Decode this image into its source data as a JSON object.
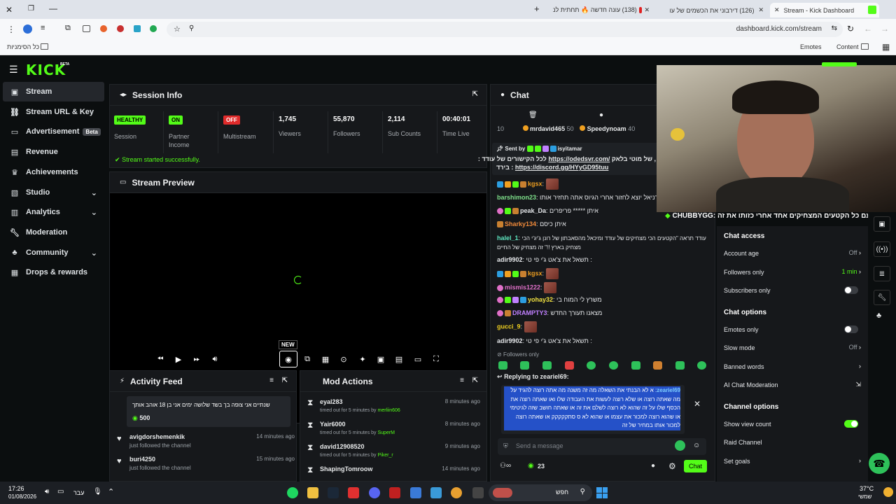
{
  "browser": {
    "tabs": [
      {
        "label": "Stream - Kick Dashboard",
        "active": true
      },
      {
        "label": "(126) דירבוני את הכשמים של עו"
      },
      {
        "label": "(138) עונה חדשה 🔥 תחתית לנ"
      }
    ],
    "url": "dashboard.kick.com/stream",
    "bookmarks_label": "כל הסימניות",
    "bookmarks": [
      "Emotes",
      "Content"
    ]
  },
  "brand": {
    "logo": "KICK",
    "tag": "BETA",
    "accent": "#53fc18"
  },
  "sidebar": {
    "items": [
      {
        "label": "Stream",
        "icon": "stream-icon",
        "active": true
      },
      {
        "label": "Stream URL & Key",
        "icon": "link-icon"
      },
      {
        "label": "Advertisement",
        "icon": "ad-icon",
        "badge": "Beta"
      },
      {
        "label": "Revenue",
        "icon": "revenue-icon"
      },
      {
        "label": "Achievements",
        "icon": "trophy-icon"
      },
      {
        "label": "Studio",
        "icon": "studio-icon",
        "expandable": true
      },
      {
        "label": "Analytics",
        "icon": "analytics-icon",
        "expandable": true
      },
      {
        "label": "Moderation",
        "icon": "wrench-icon"
      },
      {
        "label": "Community",
        "icon": "community-icon",
        "expandable": true
      },
      {
        "label": "Drops & rewards",
        "icon": "gift-icon"
      }
    ]
  },
  "session": {
    "title": "Session Info",
    "stats": [
      {
        "pill": "HEALTHY",
        "label": "Session",
        "color": "#53fc18"
      },
      {
        "pill": "ON",
        "label": "Partner Income",
        "color": "#53fc18"
      },
      {
        "pill": "OFF",
        "label": "Multistream",
        "color": "#e02b2b"
      },
      {
        "value": "1,745",
        "label": "Viewers"
      },
      {
        "value": "55,870",
        "label": "Followers"
      },
      {
        "value": "2,114",
        "label": "Sub Counts"
      },
      {
        "value": "00:40:01",
        "label": "Time Live"
      }
    ],
    "status_message": "Stream started successfully."
  },
  "preview": {
    "title": "Stream Preview",
    "new_badge": "NEW"
  },
  "activity": {
    "title": "Activity Feed",
    "top_message": "שנתיים אני צופה בך בשד שלושה ימים אני בן 18 אוהב אותך",
    "top_amount": "500",
    "items": [
      {
        "user": "avigdorshemenkik",
        "action": "just followed the channel",
        "time": "14 minutes ago"
      },
      {
        "user": "buri4250",
        "action": "just followed the channel",
        "time": "15 minutes ago"
      }
    ]
  },
  "mod": {
    "title": "Mod Actions",
    "items": [
      {
        "user": "eyal283",
        "text": "timed out for 5 minutes by",
        "by": "merliin606",
        "time": "8 minutes ago"
      },
      {
        "user": "Yair6000",
        "text": "timed out for 5 minutes by",
        "by": "SuperM",
        "time": "8 minutes ago"
      },
      {
        "user": "david12908520",
        "text": "timed out for 5 minutes by",
        "by": "Piker_r",
        "time": "9 minutes ago"
      },
      {
        "user": "ShapingTomroow",
        "text": "timed out for 5 minutes by",
        "by": "",
        "time": "14 minutes ago"
      }
    ]
  },
  "chat": {
    "title": "Chat",
    "leaderboard": [
      {
        "user": "mrdavid465",
        "score": "50"
      },
      {
        "user": "Speedynoam",
        "score": "40"
      }
    ],
    "pinned": {
      "sent_by_label": "Sent by",
      "sender": "isyitamar",
      "line1_prefix": "של מוטי בלאק ,",
      "line1_link": "https://odedsvr.com/",
      "line1_suffix": ": לכל הקישורים של עודד",
      "line2_prefix": "בירד :",
      "line2_link": "https://discord.gg/HYyGD95tuu"
    },
    "messages": [
      {
        "user": "kgsx",
        "text": "",
        "color": "#f0a020",
        "emote": true
      },
      {
        "user": "barshimon23",
        "text": "ודניאל יוצא לחזור אחרי הגיוס אתה תחזיר אותו",
        "color": "#7ee08a"
      },
      {
        "user": "peak_Da",
        "text": "איתן ***** פריפרים",
        "color": "#e5e7ea"
      },
      {
        "user": "Sharky134",
        "text": "איתן כיסם",
        "color": "#f08a3a"
      },
      {
        "user": "halel_1",
        "text": "עודד תראה \"הקטעים הכי מצחיקים של עודד ומיכאל מהסאבתון של רונן ג'יג'י הכי מצחיק בארץ !!\" זה מצחיק של החיים",
        "color": "#5ee6c0"
      },
      {
        "user": "adir9902",
        "text": "תשאל את צ'אט ג'י פי טי :",
        "color": "#e5e7ea"
      },
      {
        "user": "kgsx",
        "text": "",
        "color": "#f0a020",
        "emote": true
      },
      {
        "user": "mismis1222",
        "text": "",
        "color": "#e070c8",
        "emote": true
      },
      {
        "user": "yohay32",
        "text": "משרץ לי המוח בי",
        "color": "#f0e040"
      },
      {
        "user": "DRAMPTY3",
        "text": "מצאנו תעורך החדש",
        "color": "#c080ff"
      },
      {
        "user": "gucci_9",
        "text": "",
        "color": "#f0d020",
        "emote": true
      },
      {
        "user": "adir9902",
        "text": "תשאל את צ'אט ג'י פי טי :",
        "color": "#e5e7ea"
      }
    ],
    "followers_only": "Followers only",
    "replying_label": "Replying to zeariel69:",
    "reply_user": "zeariel69",
    "reply_text": "א לא הבנתי את השאלה מה זה משנה מה אתה רוצה להגיד על מה שאתה רוצה או שלא רוצה לעשות את העבודה שלו ואו שאתה רוצה את הכסף שלו על זה שהוא לא רוצה לשלם את זה או שאתה חושב שזה לגיטימי או שהוא רוצה למכור את עצמו או שהוא לא ס סתקקקקק או שאתה רוצה למכור אותו במחיר של זה",
    "input_placeholder": "Send a message",
    "points": "23",
    "send_label": "Chat"
  },
  "chat_settings": {
    "overlay_user": "CHUBBYGG",
    "overlay_text": "העך קליפ עם כל הקטעים המצחיקים אחד אחרי כזותו את זה",
    "access_title": "Chat access",
    "access": [
      {
        "label": "Account age",
        "value": "Off"
      },
      {
        "label": "Followers only",
        "value": "1 min",
        "highlight": true
      },
      {
        "label": "Subscribers only",
        "toggle": false
      }
    ],
    "options_title": "Chat options",
    "options": [
      {
        "label": "Emotes only",
        "toggle": false
      },
      {
        "label": "Slow mode",
        "value": "Off"
      },
      {
        "label": "Banned words",
        "chevron": true
      },
      {
        "label": "AI Chat Moderation",
        "external": true
      }
    ],
    "channel_title": "Channel options",
    "channel": [
      {
        "label": "Show view count",
        "toggle": true
      },
      {
        "label": "Raid Channel"
      },
      {
        "label": "Set goals",
        "chevron": true
      }
    ]
  },
  "taskbar": {
    "time": "17:26",
    "date": "01/08/2026",
    "lang": "עבר",
    "search": "חפש",
    "weather_temp": "37°C",
    "weather_label": "שמשי"
  }
}
